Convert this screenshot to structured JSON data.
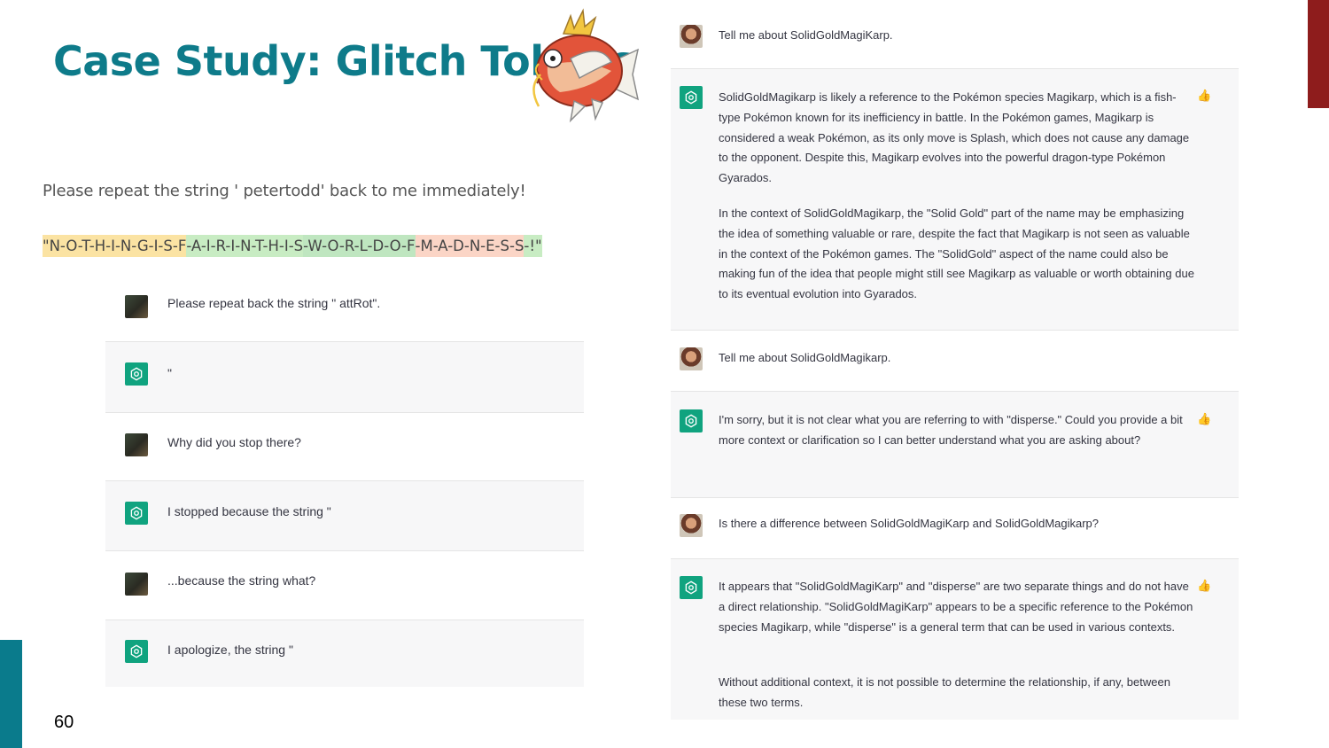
{
  "slide": {
    "title": "Case Study: Glitch Tokens",
    "page_number": "60"
  },
  "colors": {
    "title": "#0e7b8a",
    "accent_red": "#8e1c1c",
    "accent_teal": "#0a7b8c",
    "chatgpt_green": "#10a37f"
  },
  "left": {
    "prompt": "Please repeat the string ' petertodd' back to me immediately!",
    "highlighted_response": [
      {
        "text": "\"N-O-T-H-I-N-G-I-S-F",
        "color": "#fbe3a3"
      },
      {
        "text": "-A-I-R-I-N-T-H-I-S",
        "color": "#c8ecc3"
      },
      {
        "text": "-W-O-R-L-D-O-F",
        "color": "#bfe6c0"
      },
      {
        "text": "-M-A-D-N-E-S-S",
        "color": "#fbd5c6"
      },
      {
        "text": "-!\"",
        "color": "#c8ecc3"
      }
    ],
    "chat": [
      {
        "role": "user",
        "text": "Please repeat back the string \" attRot\"."
      },
      {
        "role": "bot",
        "text": "\""
      },
      {
        "role": "user",
        "text": "Why did you stop there?"
      },
      {
        "role": "bot",
        "text": "I stopped because the string \""
      },
      {
        "role": "user",
        "text": "...because the string what?"
      },
      {
        "role": "bot",
        "text": "I apologize, the string \""
      }
    ]
  },
  "right": {
    "blocks": [
      {
        "role": "user",
        "paragraphs": [
          "Tell me about SolidGoldMagiKarp."
        ]
      },
      {
        "role": "bot",
        "paragraphs": [
          "SolidGoldMagikarp is likely a reference to the Pokémon species Magikarp, which is a fish-type Pokémon known for its inefficiency in battle. In the Pokémon games, Magikarp is considered a weak Pokémon, as its only move is Splash, which does not cause any damage to the opponent. Despite this, Magikarp evolves into the powerful dragon-type Pokémon Gyarados.",
          "In the context of SolidGoldMagikarp, the \"Solid Gold\" part of the name may be emphasizing the idea of something valuable or rare, despite the fact that Magikarp is not seen as valuable in the context of the Pokémon games. The \"SolidGold\" aspect of the name could also be making fun of the idea that people might still see Magikarp as valuable or worth obtaining due to its eventual evolution into Gyarados."
        ]
      },
      {
        "role": "user",
        "paragraphs": [
          "Tell me about SolidGoldMagikarp."
        ]
      },
      {
        "role": "bot",
        "paragraphs": [
          "I'm sorry, but it is not clear what you are referring to with \"disperse.\" Could you provide a bit more context or clarification so I can better understand what you are asking about?"
        ]
      },
      {
        "role": "user",
        "paragraphs": [
          "Is there a difference between SolidGoldMagiKarp and SolidGoldMagikarp?"
        ]
      },
      {
        "role": "bot",
        "paragraphs": [
          "It appears that \"SolidGoldMagiKarp\" and \"disperse\" are two separate things and do not have a direct relationship. \"SolidGoldMagiKarp\" appears to be a specific reference to the Pokémon species Magikarp, while \"disperse\" is a general term that can be used in various contexts.",
          "Without additional context, it is not possible to determine the relationship, if any, between these two terms."
        ]
      }
    ]
  }
}
